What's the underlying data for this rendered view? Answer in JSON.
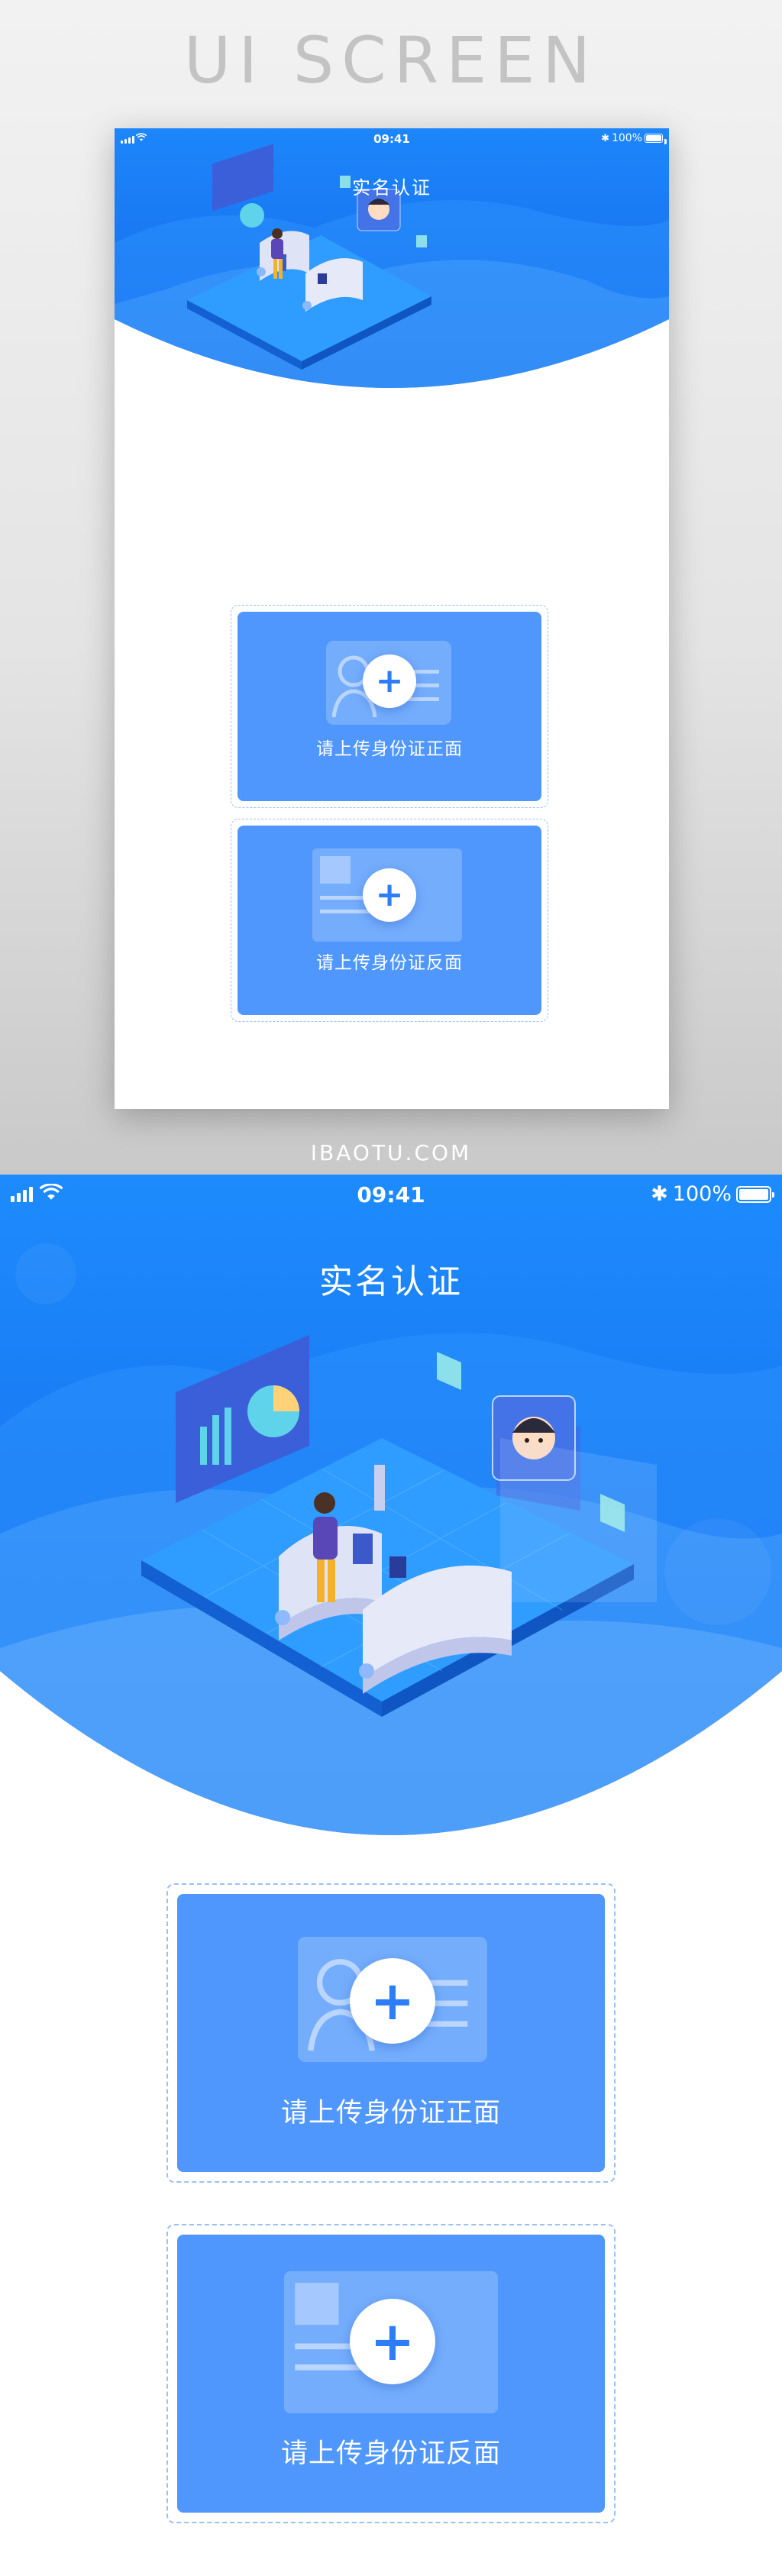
{
  "showcase": {
    "title": "UI SCREEN",
    "watermark": "IBAOTU.COM"
  },
  "status_bar": {
    "time": "09:41",
    "battery": "100%",
    "icons": [
      "signal-icon",
      "wifi-icon",
      "bluetooth-icon",
      "battery-icon"
    ]
  },
  "page": {
    "title": "实名认证"
  },
  "upload_cards": [
    {
      "label": "请上传身份证正面",
      "icon": "plus-icon",
      "illustration": "id-card-front-icon"
    },
    {
      "label": "请上传身份证反面",
      "icon": "plus-icon",
      "illustration": "id-card-back-icon"
    }
  ],
  "colors": {
    "hero_blue": "#1a7bf5",
    "hero_light": "#3aa0ff",
    "card_blue": "#4f96fd",
    "dashed_border": "#9cc0f4",
    "plus_blue": "#2d7df6"
  }
}
